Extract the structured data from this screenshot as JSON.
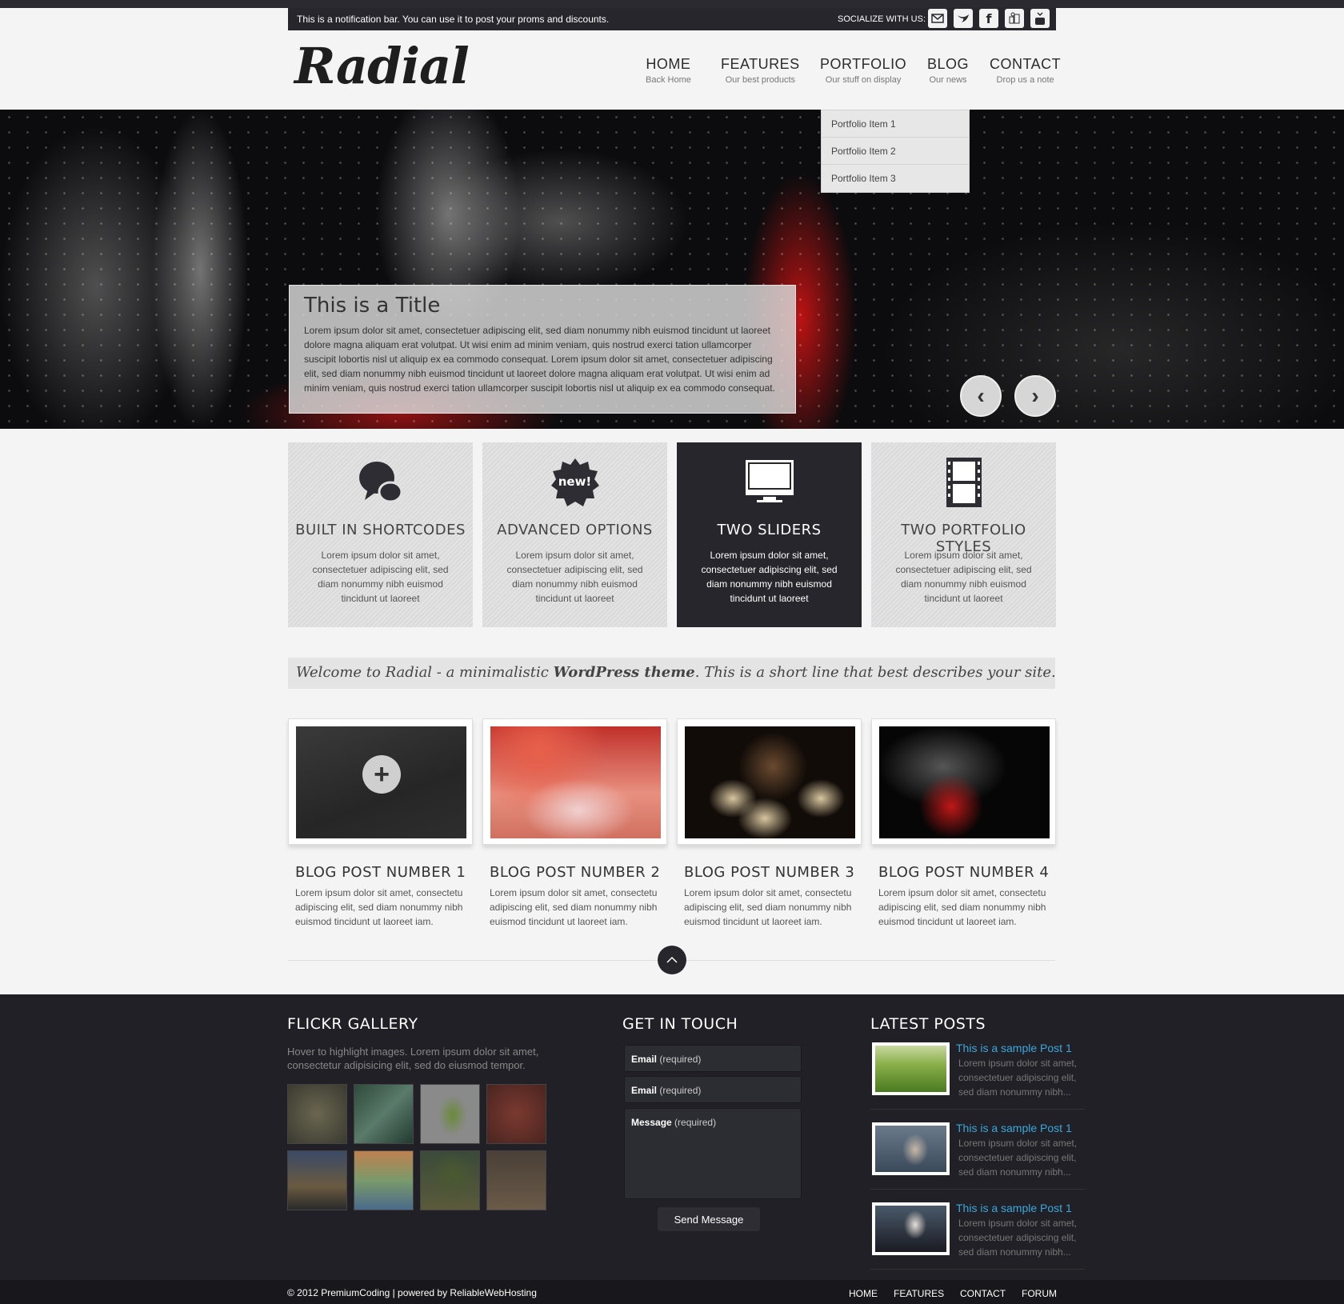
{
  "notification": {
    "message": "This is a notification bar. You can use it to post your proms and discounts.",
    "socialize_label": "SOCIALIZE WITH US:",
    "social_icons": [
      "email-icon",
      "twitter-icon",
      "facebook-icon",
      "flickr-icon",
      "youtube-icon"
    ]
  },
  "header": {
    "logo": "Radial",
    "nav": [
      {
        "label": "HOME",
        "sub": "Back Home"
      },
      {
        "label": "FEATURES",
        "sub": "Our best products"
      },
      {
        "label": "PORTFOLIO",
        "sub": "Our stuff on display"
      },
      {
        "label": "BLOG",
        "sub": "Our news"
      },
      {
        "label": "CONTACT",
        "sub": "Drop us a note"
      }
    ],
    "dropdown": [
      "Portfolio Item 1",
      "Portfolio Item 2",
      "Portfolio Item 3"
    ]
  },
  "slider": {
    "title": "This is a Title",
    "text": "Lorem ipsum dolor sit amet, consectetuer adipiscing elit, sed diam nonummy nibh euismod tincidunt ut laoreet dolore magna aliquam erat volutpat. Ut wisi enim ad minim veniam, quis nostrud exerci tation ullamcorper suscipit lobortis nisl ut aliquip ex ea commodo consequat. Lorem ipsum dolor sit amet, consectetuer adipiscing elit, sed diam nonummy nibh euismod tincidunt ut laoreet dolore magna aliquam erat volutpat. Ut wisi enim ad minim veniam, quis nostrud exerci tation ullamcorper suscipit lobortis nisl ut aliquip ex ea commodo consequat.",
    "prev_label": "‹",
    "next_label": "›"
  },
  "features": [
    {
      "title": "BUILT IN SHORTCODES",
      "text": "Lorem ipsum dolor sit amet, consectetuer adipiscing elit, sed diam nonummy nibh euismod tincidunt ut laoreet",
      "icon": "speech-bubbles-icon"
    },
    {
      "title": "ADVANCED OPTIONS",
      "text": "Lorem ipsum dolor sit amet, consectetuer adipiscing elit, sed diam nonummy nibh euismod tincidunt ut laoreet",
      "icon": "new-badge-icon",
      "badge": "new!"
    },
    {
      "title": "TWO SLIDERS",
      "text": "Lorem ipsum dolor sit amet, consectetuer adipiscing elit, sed diam nonummy nibh euismod tincidunt ut laoreet",
      "icon": "monitor-icon"
    },
    {
      "title": "TWO PORTFOLIO STYLES",
      "text": "Lorem ipsum dolor sit amet, consectetuer adipiscing elit, sed diam nonummy nibh euismod tincidunt ut laoreet",
      "icon": "film-strip-icon"
    }
  ],
  "tagline": {
    "before": "Welcome to Radial - a minimalistic ",
    "bold": "WordPress theme",
    "after": ". This is a short line that best describes your site."
  },
  "blog": [
    {
      "title": "BLOG POST NUMBER 1",
      "excerpt": "Lorem ipsum dolor sit amet, consectetu adipiscing elit, sed diam nonummy nibh euismod tincidunt ut laoreet iam.",
      "overlay": "+"
    },
    {
      "title": "BLOG POST NUMBER 2",
      "excerpt": "Lorem ipsum dolor sit amet, consectetu adipiscing elit, sed diam nonummy nibh euismod tincidunt ut laoreet iam."
    },
    {
      "title": "BLOG POST NUMBER 3",
      "excerpt": "Lorem ipsum dolor sit amet, consectetu adipiscing elit, sed diam nonummy nibh euismod tincidunt ut laoreet iam."
    },
    {
      "title": "BLOG POST NUMBER 4",
      "excerpt": "Lorem ipsum dolor sit amet, consectetu adipiscing elit, sed diam nonummy nibh euismod tincidunt ut laoreet iam."
    }
  ],
  "footer": {
    "flickr": {
      "title": "FLICKR GALLERY",
      "desc": "Hover to highlight images. Lorem ipsum dolor sit amet, consectetur adipisicing elit, sed do eiusmod tempor."
    },
    "contact": {
      "title": "GET IN TOUCH",
      "fields": [
        {
          "label": "Email",
          "hint": "(required)"
        },
        {
          "label": "Email",
          "hint": "(required)"
        },
        {
          "label": "Message",
          "hint": "(required)"
        }
      ],
      "send_label": "Send Message"
    },
    "latest": {
      "title": "LATEST POSTS",
      "posts": [
        {
          "title": "This is a sample Post 1",
          "text": "Lorem ipsum dolor sit amet, consectetuer adipiscing elit, sed diam nonummy nibh..."
        },
        {
          "title": "This is a sample Post 1",
          "text": "Lorem ipsum dolor sit amet, consectetuer adipiscing elit, sed diam nonummy nibh..."
        },
        {
          "title": "This is a sample Post 1",
          "text": "Lorem ipsum dolor sit amet, consectetuer adipiscing elit, sed diam nonummy nibh..."
        }
      ]
    }
  },
  "bottom": {
    "copyright": "© 2012 PremiumCoding | powered by ReliableWebHosting",
    "nav": [
      "HOME",
      "FEATURES",
      "CONTACT",
      "FORUM"
    ]
  },
  "colors": {
    "accent_link": "#39a8dc",
    "dark": "#26262c",
    "footer_bg": "#202026"
  }
}
